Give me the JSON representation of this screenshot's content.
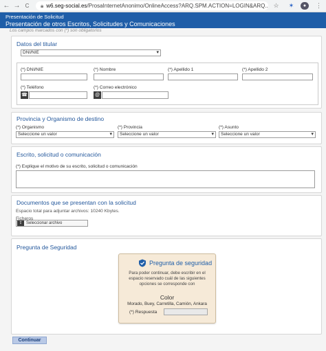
{
  "browser": {
    "address_domain": "w6.seg-social.es",
    "address_path": "/ProsaInternetAnonimo/OnlineAccess?ARQ.SPM.ACTION=LOGIN&ARQ...",
    "back": "←",
    "forward": "→",
    "reload": "C",
    "star": "☆",
    "ext": "✶",
    "menu": "⋮"
  },
  "header": {
    "title": "Presentación de Solicitud",
    "subtitle": "Presentación de otros Escritos, Solicitudes y Comunicaciones",
    "note": "Los campos marcados con (*) son obligatorios"
  },
  "titular": {
    "title": "Datos del titular",
    "doc_type": "DNI/NIE",
    "dni_label": "(*) DNI/NIE",
    "nombre_label": "(*) Nombre",
    "apellido1_label": "(*) Apellido 1",
    "apellido2_label": "(*) Apellido 2",
    "telefono_label": "(*) Teléfono",
    "correo_label": "(*) Correo electrónico"
  },
  "destino": {
    "title": "Provincia y Organismo de destino",
    "organismo_label": "(*) Organismo",
    "provincia_label": "(*) Provincia",
    "asunto_label": "(*) Asunto",
    "organismo_value": "Seleccione un valor",
    "provincia_value": "Seleccione un valor",
    "asunto_value": "Seleccione un valor"
  },
  "escrito": {
    "title": "Escrito, solicitud o comunicación",
    "label": "(*) Explique el motivo de su escrito, solicitud o comunicación"
  },
  "documentos": {
    "title": "Documentos que se presentan con la solicitud",
    "space": "Espacio total para adjuntar archivos: 10240 Kbytes.",
    "ficheros": "Ficheros",
    "select_file": "Seleccionar archivo"
  },
  "seguridad": {
    "title": "Pregunta de Seguridad",
    "captcha_title": "Pregunta de seguridad",
    "message": "Para poder continuar, debe escribir en el espacio reservado cuál de las siguientes opciones se corresponde con",
    "word": "Color",
    "options": "Morado, Buey, Carretilla, Camión, Ankara",
    "answer_label": "(*) Respuesta"
  },
  "actions": {
    "continue": "Continuar"
  }
}
